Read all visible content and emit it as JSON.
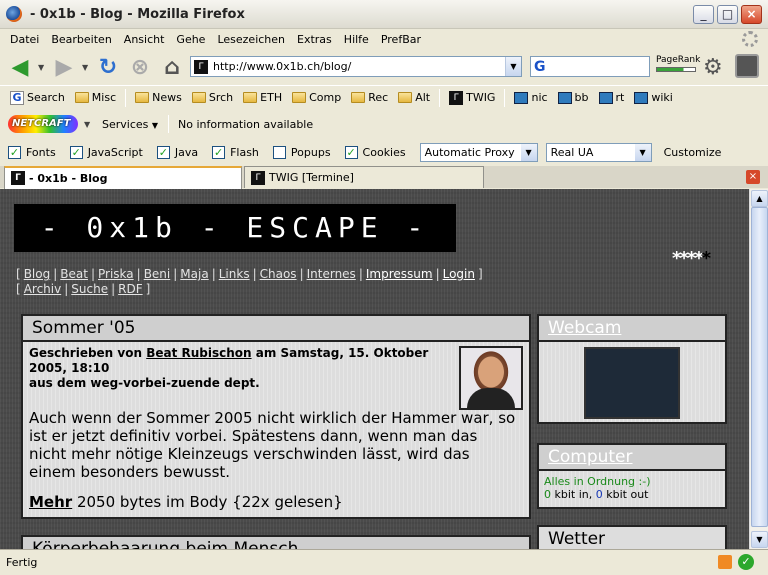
{
  "window": {
    "title": "- 0x1b - Blog - Mozilla Firefox"
  },
  "menu": [
    "Datei",
    "Bearbeiten",
    "Ansicht",
    "Gehe",
    "Lesezeichen",
    "Extras",
    "Hilfe",
    "PrefBar"
  ],
  "navbar": {
    "url": "http://www.0x1b.ch/blog/",
    "pagerank_label": "PageRank",
    "pagerank_level": 0.7
  },
  "bookmarks": {
    "search": "Search",
    "folders": [
      "Misc",
      "News",
      "Srch",
      "ETH",
      "Comp",
      "Rec",
      "Alt"
    ],
    "twig": "TWIG",
    "links": [
      "nic",
      "bb",
      "rt",
      "wiki"
    ]
  },
  "netcraft": {
    "logo": "NETCRAFT",
    "services": "Services",
    "info": "No information available"
  },
  "prefbar": {
    "checks": [
      {
        "label": "Fonts",
        "checked": true
      },
      {
        "label": "JavaScript",
        "checked": true
      },
      {
        "label": "Java",
        "checked": true
      },
      {
        "label": "Flash",
        "checked": true
      },
      {
        "label": "Popups",
        "checked": false
      },
      {
        "label": "Cookies",
        "checked": true
      }
    ],
    "proxy": "Automatic Proxy",
    "ua": "Real UA",
    "customize": "Customize"
  },
  "tabs": [
    "- 0x1b - Blog",
    "TWIG [Termine]"
  ],
  "page": {
    "logo": "- 0x1b - ESCAPE -",
    "stars": "****",
    "star_last": "*",
    "nav1": [
      "Blog",
      "Beat",
      "Priska",
      "Beni",
      "Maja",
      "Links",
      "Chaos",
      "Internes",
      "Impressum",
      "Login"
    ],
    "nav2": [
      "Archiv",
      "Suche",
      "RDF"
    ],
    "article": {
      "title": "Sommer '05",
      "meta_prefix": "Geschrieben von ",
      "author": "Beat Rubischon",
      "meta_date": " am Samstag, 15. Oktober 2005, 18:10",
      "meta_dept": "aus dem weg-vorbei-zuende dept.",
      "body": "Auch wenn der Sommer 2005 nicht wirklich der Hammer war, so ist er jetzt definitiv vorbei. Spätestens dann, wenn man das nicht mehr nötige Kleinzeugs verschwinden lässt, wird das einem besonders bewusst.",
      "more": "Mehr",
      "more_info": " 2050 bytes im Body {22x gelesen}"
    },
    "article2_title": "Körperbehaarung beim Mensch",
    "webcam_title": "Webcam",
    "computer": {
      "title": "Computer",
      "status": "Alles in Ordnung :-)",
      "in": "0",
      "in_label": " kbit in, ",
      "out": "0",
      "out_label": " kbit out"
    },
    "wetter_title": "Wetter"
  },
  "status": "Fertig"
}
